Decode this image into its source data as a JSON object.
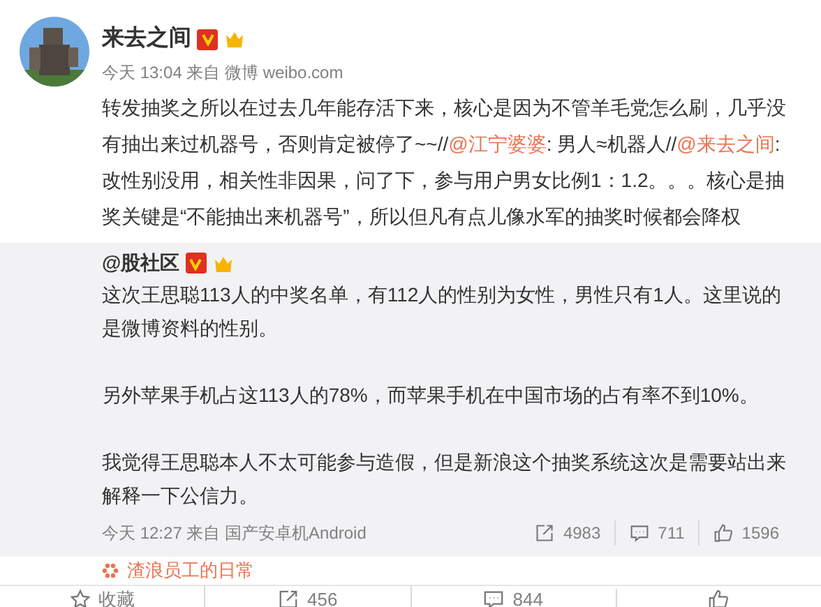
{
  "post": {
    "author": "来去之间",
    "verified": true,
    "member": true,
    "meta": "今天 13:04 来自 微博 weibo.com",
    "content": [
      {
        "kind": "text",
        "text": "转发抽奖之所以在过去几年能存活下来，核心是因为不管羊毛党怎么刷，几乎没有抽出来过机器号，否则肯定被停了~~//"
      },
      {
        "kind": "mention",
        "text": "@江宁婆婆"
      },
      {
        "kind": "text",
        "text": ": 男人≈机器人//"
      },
      {
        "kind": "mention",
        "text": "@来去之间"
      },
      {
        "kind": "text",
        "text": ":改性别没用，相关性非因果，问了下，参与用户男女比例1：1.2。。。核心是抽奖关键是“不能抽出来机器号”，所以但凡有点儿像水军的抽奖时候都会降权"
      }
    ]
  },
  "repost": {
    "author": "@股社区",
    "verified": true,
    "member": true,
    "paragraphs": [
      "这次王思聪113人的中奖名单，有112人的性别为女性，男性只有1人。这里说的是微博资料的性别。",
      "另外苹果手机占这113人的78%，而苹果手机在中国市场的占有率不到10%。",
      "我觉得王思聪本人不太可能参与造假，但是新浪这个抽奖系统这次是需要站出来解释一下公信力。"
    ],
    "meta": "今天 12:27 来自 国产安卓机Android",
    "stats": [
      {
        "kind": "repost",
        "count": "4983"
      },
      {
        "kind": "comment",
        "count": "711"
      },
      {
        "kind": "like",
        "count": "1596"
      }
    ]
  },
  "topic": "渣浪员工的日常",
  "actions": [
    {
      "kind": "favorite",
      "label": "收藏"
    },
    {
      "kind": "repost",
      "label": "456"
    },
    {
      "kind": "comment",
      "label": "844"
    },
    {
      "kind": "like"
    }
  ]
}
